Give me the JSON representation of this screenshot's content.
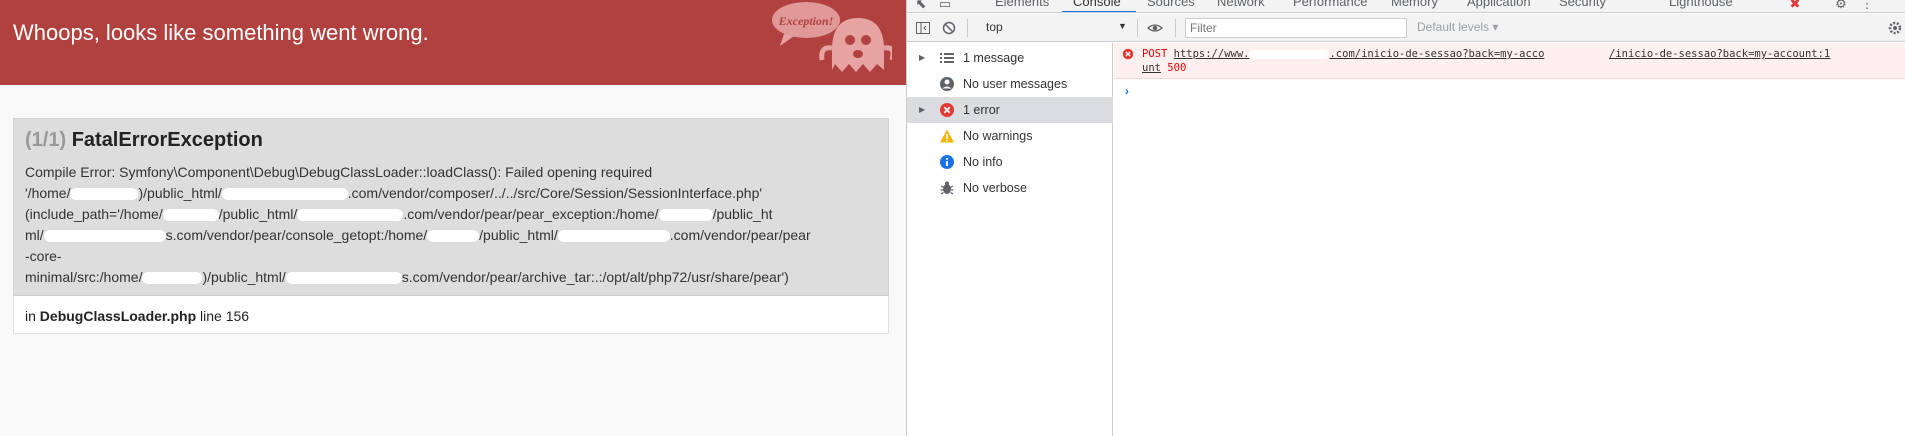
{
  "left": {
    "header_title": "Whoops, looks like something went wrong.",
    "ghost_label": "Exception!",
    "exception": {
      "count": "(1/1)",
      "name": "FatalErrorException",
      "message_lines": [
        "Compile Error: Symfony\\Component\\Debug\\DebugClassLoader::loadClass(): Failed opening required",
        "'/home/",
        ")/public_html/",
        ".com/vendor/composer/../../src/Core/Session/SessionInterface.php'",
        "(include_path='/home/",
        "/public_html/",
        ".com/vendor/pear/pear_exception:/home/",
        "/public_ht",
        "ml/",
        "s.com/vendor/pear/console_getopt:/home/",
        "/public_html/",
        ".com/vendor/pear/pear",
        "-core-",
        "minimal/src:/home/",
        ")/public_html/",
        "s.com/vendor/pear/archive_tar:.:/opt/alt/php72/usr/share/pear')"
      ],
      "location_prefix": "in",
      "location_file": "DebugClassLoader.php",
      "location_line": "line 156"
    }
  },
  "devtools": {
    "tabs": [
      "Elements",
      "Console",
      "Sources",
      "Network",
      "Performance",
      "Memory",
      "Application",
      "Security",
      "Lighthouse"
    ],
    "active_tab": "Console",
    "context": "top",
    "filter_placeholder": "Filter",
    "levels_label": "Default levels",
    "sidebar": [
      {
        "label": "1 message",
        "icon": "list-icon",
        "expandable": true
      },
      {
        "label": "No user messages",
        "icon": "user-icon",
        "expandable": false
      },
      {
        "label": "1 error",
        "icon": "error-icon",
        "expandable": true,
        "selected": true
      },
      {
        "label": "No warnings",
        "icon": "warning-icon",
        "expandable": false
      },
      {
        "label": "No info",
        "icon": "info-icon",
        "expandable": false
      },
      {
        "label": "No verbose",
        "icon": "bug-icon",
        "expandable": false
      }
    ],
    "console": {
      "method": "POST",
      "url_prefix": "https://www.",
      "url_suffix": ".com/inicio-de-sessao?back=my-acco",
      "url_wrap": "unt",
      "source": "/inicio-de-sessao?back=my-account:1",
      "status": "500"
    },
    "colors": {
      "error": "#e53935",
      "warning": "#f4b400",
      "info": "#1a73e8",
      "header_bg": "#b0413e"
    }
  }
}
